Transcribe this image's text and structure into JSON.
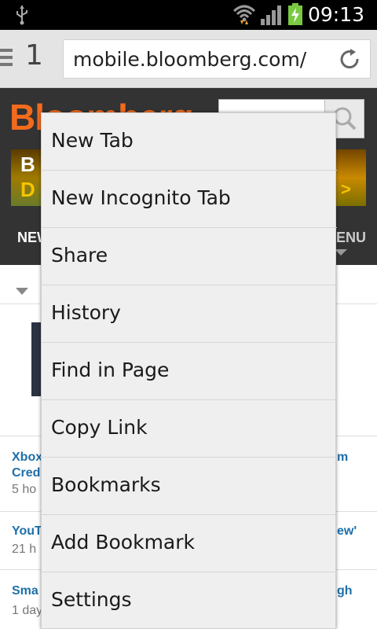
{
  "status_bar": {
    "time": "09:13"
  },
  "toolbar": {
    "tab_count": "1",
    "url": "mobile.bloomberg.com/"
  },
  "page": {
    "logo_text": "Bloomberg",
    "promo_left_text": "B",
    "promo_left_sub": "D",
    "promo_right_text": ">",
    "nav_left": "NEW",
    "nav_right": "ENU",
    "stories": [
      {
        "left": "Xbox",
        "left2": "Cred",
        "right": "m",
        "meta": "5 ho"
      },
      {
        "left": "YouT",
        "right": "ew'",
        "meta": "21 h"
      },
      {
        "left": "Sma",
        "right": "gh",
        "meta": "1 day"
      }
    ]
  },
  "menu": {
    "items": [
      "New Tab",
      "New Incognito Tab",
      "Share",
      "History",
      "Find in Page",
      "Copy Link",
      "Bookmarks",
      "Add Bookmark",
      "Settings"
    ]
  }
}
